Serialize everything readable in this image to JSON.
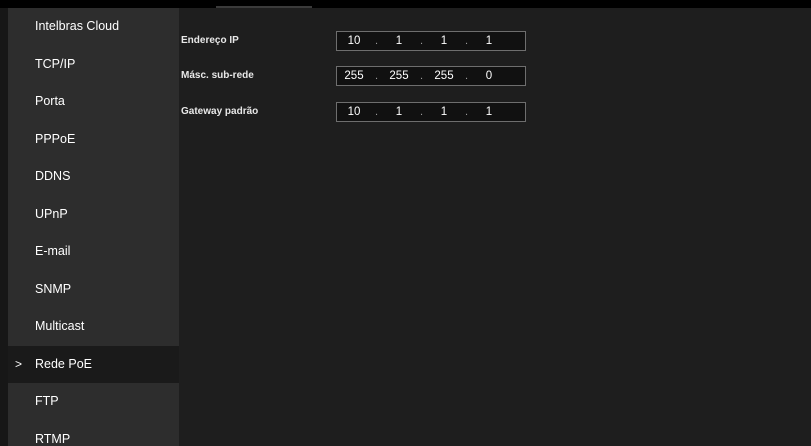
{
  "sidebar": {
    "items": [
      {
        "label": "Intelbras Cloud",
        "active": false
      },
      {
        "label": "TCP/IP",
        "active": false
      },
      {
        "label": "Porta",
        "active": false
      },
      {
        "label": "PPPoE",
        "active": false
      },
      {
        "label": "DDNS",
        "active": false
      },
      {
        "label": "UPnP",
        "active": false
      },
      {
        "label": "E-mail",
        "active": false
      },
      {
        "label": "SNMP",
        "active": false
      },
      {
        "label": "Multicast",
        "active": false
      },
      {
        "label": "Rede PoE",
        "active": true
      },
      {
        "label": "FTP",
        "active": false
      },
      {
        "label": "RTMP",
        "active": false
      }
    ],
    "active_marker": ">"
  },
  "form": {
    "ip_address": {
      "label": "Endereço IP",
      "octets": [
        "10",
        "1",
        "1",
        "1"
      ]
    },
    "subnet_mask": {
      "label": "Másc. sub-rede",
      "octets": [
        "255",
        "255",
        "255",
        "0"
      ]
    },
    "gateway": {
      "label": "Gateway padrão",
      "octets": [
        "10",
        "1",
        "1",
        "1"
      ]
    },
    "separator": "."
  },
  "colors": {
    "background": "#1e1e1e",
    "sidebar": "#2d2d2d",
    "active_item": "#1a1a1a",
    "text": "#ffffff",
    "input_border": "#6e6e6e"
  }
}
